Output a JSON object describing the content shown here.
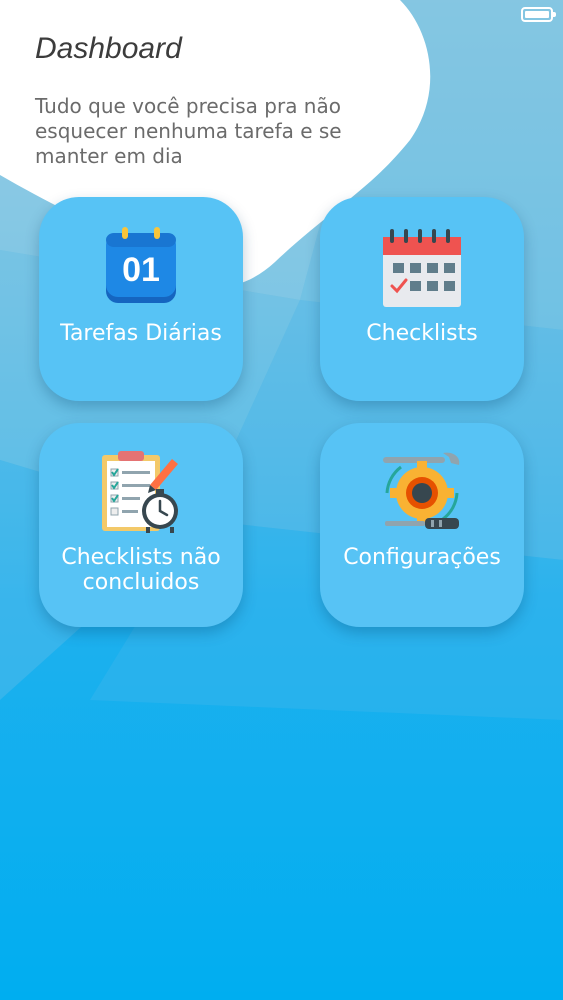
{
  "header": {
    "title": "Dashboard",
    "subtitle": "Tudo que você precisa pra não esquecer nenhuma tarefa e se manter em dia"
  },
  "status_bar": {
    "battery_icon": "battery-icon"
  },
  "tiles": [
    {
      "label": "Tarefas Diárias",
      "icon": "calendar-day-icon",
      "icon_text": "01"
    },
    {
      "label": "Checklists",
      "icon": "calendar-grid-icon"
    },
    {
      "label": "Checklists não concluidos",
      "icon": "clipboard-clock-icon"
    },
    {
      "label": "Configurações",
      "icon": "gear-tools-icon"
    }
  ],
  "colors": {
    "tile": "#57c3f5",
    "tile_label": "#ffffff",
    "title": "#3c3c3c",
    "subtitle": "#6b6b6b",
    "background_top": "#8ec8e0",
    "background_bottom": "#00aef0"
  }
}
